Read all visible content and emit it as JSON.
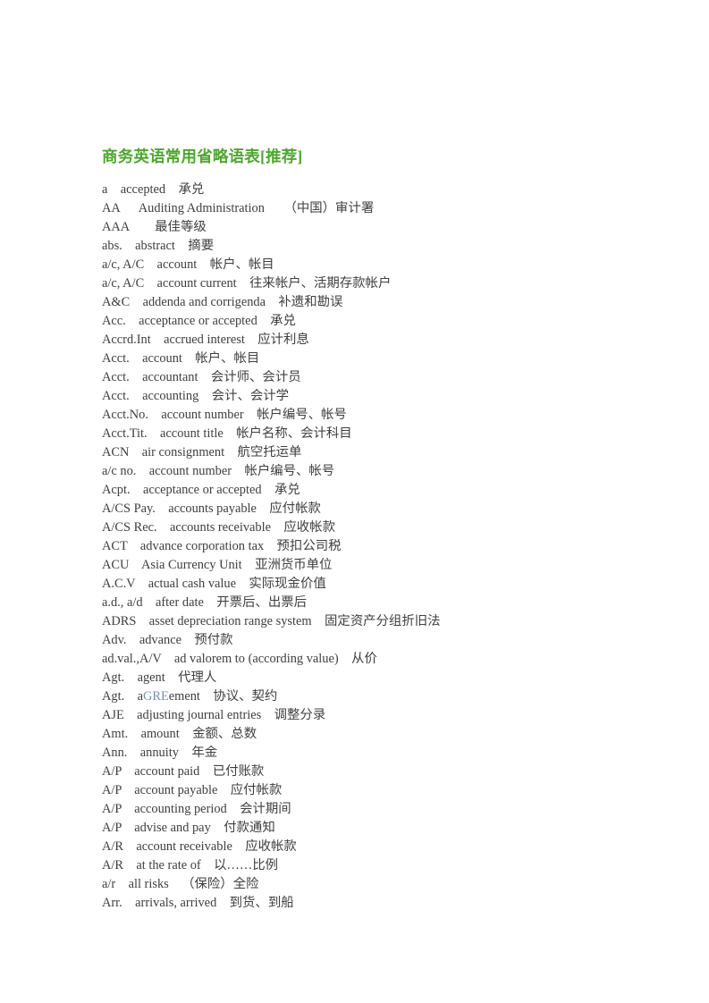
{
  "document": {
    "title": "商务英语常用省略语表[推荐]",
    "title_color": "#4ea72e",
    "body_color": "#3f3f3f",
    "background_color": "#ffffff",
    "highlight_color": "#7a8fb0"
  },
  "entries": [
    {
      "line": "a    accepted    承兑"
    },
    {
      "line": "AA      Auditing Administration      （中国）审计署"
    },
    {
      "line": "AAA        最佳等级"
    },
    {
      "line": "abs.    abstract    摘要"
    },
    {
      "line": "a/c, A/C    account    帐户、帐目"
    },
    {
      "line": "a/c, A/C    account current    往来帐户、活期存款帐户"
    },
    {
      "line": "A&C    addenda and corrigenda    补遗和勘误"
    },
    {
      "line": "Acc.    acceptance or accepted    承兑"
    },
    {
      "line": "Accrd.Int    accrued interest    应计利息"
    },
    {
      "line": "Acct.    account    帐户、帐目"
    },
    {
      "line": "Acct.    accountant    会计师、会计员"
    },
    {
      "line": "Acct.    accounting    会计、会计学"
    },
    {
      "line": "Acct.No.    account number    帐户编号、帐号"
    },
    {
      "line": "Acct.Tit.    account title    帐户名称、会计科目"
    },
    {
      "line": "ACN    air consignment    航空托运单"
    },
    {
      "line": "a/c no.    account number    帐户编号、帐号"
    },
    {
      "line": "Acpt.    acceptance or accepted    承兑"
    },
    {
      "line": "A/CS Pay.    accounts payable    应付帐款"
    },
    {
      "line": "A/CS Rec.    accounts receivable    应收帐款"
    },
    {
      "line": "ACT    advance corporation tax    预扣公司税"
    },
    {
      "line": "ACU    Asia Currency Unit    亚洲货币单位"
    },
    {
      "line": "A.C.V    actual cash value    实际现金价值"
    },
    {
      "line": "a.d., a/d    after date    开票后、出票后"
    },
    {
      "line": "ADRS    asset depreciation range system    固定资产分组折旧法"
    },
    {
      "line": "Adv.    advance    预付款"
    },
    {
      "line": "ad.val.,A/V    ad valorem to (according value)    从价"
    },
    {
      "line": "Agt.    agent    代理人"
    },
    {
      "prefix": "Agt.    a",
      "highlight": "GRE",
      "suffix": "ement    协议、契约"
    },
    {
      "line": "AJE    adjusting journal entries    调整分录"
    },
    {
      "line": "Amt.    amount    金额、总数"
    },
    {
      "line": "Ann.    annuity    年金"
    },
    {
      "line": "A/P    account paid    已付账款"
    },
    {
      "line": "A/P    account payable    应付帐款"
    },
    {
      "line": "A/P    accounting period    会计期间"
    },
    {
      "line": "A/P    advise and pay    付款通知"
    },
    {
      "line": "A/R    account receivable    应收帐款"
    },
    {
      "line": "A/R    at the rate of    以……比例"
    },
    {
      "line": "a/r    all risks    （保险）全险"
    },
    {
      "line": "Arr.    arrivals, arrived    到货、到船"
    }
  ]
}
